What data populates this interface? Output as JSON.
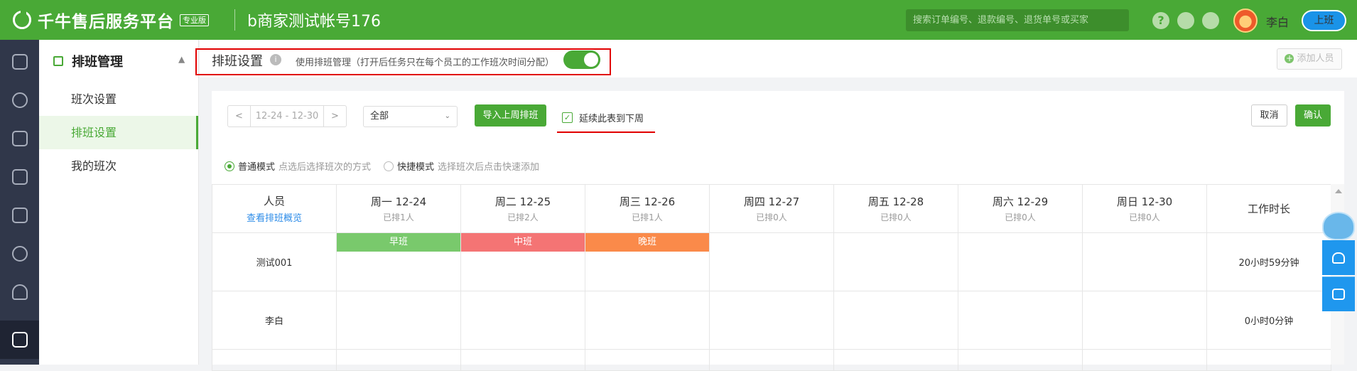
{
  "header": {
    "brand": "千牛售后服务平台",
    "edition_badge": "专业版",
    "account_name": "b商家测试帐号176",
    "search_placeholder": "搜索订单编号、退款编号、退货单号或买家",
    "help_icon_text": "?",
    "user_name": "李白",
    "duty_button": "上班"
  },
  "left_rail": {
    "icons": [
      "home-icon",
      "yuan-icon",
      "rocket-icon",
      "list-icon",
      "service-icon",
      "compass-icon",
      "people-icon",
      "calendar-icon"
    ],
    "active_index": 7
  },
  "sidebar": {
    "group_title": "排班管理",
    "items": [
      {
        "label": "班次设置",
        "active": false
      },
      {
        "label": "排班设置",
        "active": true
      },
      {
        "label": "我的班次",
        "active": false
      }
    ]
  },
  "page_header": {
    "title": "排班设置",
    "info_icon_text": "i",
    "description": "使用排班管理（打开后任务只在每个员工的工作班次时间分配）",
    "toggle_on": true,
    "add_staff_label": "添加人员"
  },
  "toolbar": {
    "prev": "<",
    "next": ">",
    "week_range": "12-24 - 12-30",
    "filter_value": "全部",
    "filter_chevron": "⌄",
    "import_label": "导入上周排班",
    "continue_checked": true,
    "check_mark": "✓",
    "continue_label": "延续此表到下周",
    "cancel_label": "取消",
    "confirm_label": "确认"
  },
  "modes": {
    "normal_label": "普通模式",
    "normal_hint": "点选后选择班次的方式",
    "quick_label": "快捷模式",
    "quick_hint": "选择班次后点击快速添加",
    "selected": "normal"
  },
  "schedule": {
    "person_header": "人员",
    "overview_link": "查看排班概览",
    "hours_header": "工作时长",
    "days": [
      {
        "label": "周一 12-24",
        "count": "已排1人"
      },
      {
        "label": "周二 12-25",
        "count": "已排2人"
      },
      {
        "label": "周三 12-26",
        "count": "已排1人"
      },
      {
        "label": "周四 12-27",
        "count": "已排0人"
      },
      {
        "label": "周五 12-28",
        "count": "已排0人"
      },
      {
        "label": "周六 12-29",
        "count": "已排0人"
      },
      {
        "label": "周日 12-30",
        "count": "已排0人"
      }
    ],
    "rows": [
      {
        "name": "测试001",
        "shifts": [
          "早班",
          "中班",
          "晚班",
          "",
          "",
          "",
          ""
        ],
        "hours": "20小时59分钟"
      },
      {
        "name": "李白",
        "shifts": [
          "",
          "",
          "",
          "",
          "",
          "",
          ""
        ],
        "hours": "0小时0分钟"
      }
    ],
    "shift_colors": {
      "早班": "#79c96c",
      "中班": "#f47474",
      "晚班": "#fa8a4a"
    }
  },
  "colors": {
    "brand_green": "#49a936",
    "highlight_red": "#e10000",
    "rail_dark": "#30374a",
    "link_blue": "#2d8ce8"
  }
}
